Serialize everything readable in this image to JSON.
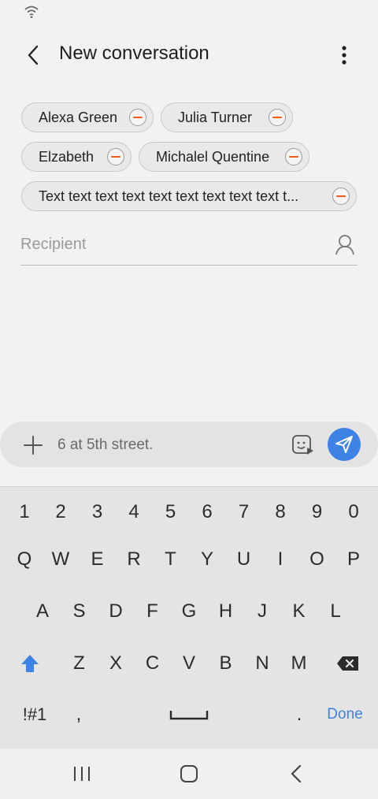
{
  "app_bar": {
    "title": "New conversation"
  },
  "recipients": [
    {
      "name": "Alexa Green"
    },
    {
      "name": "Julia Turner"
    },
    {
      "name": "Elzabeth"
    },
    {
      "name": "Michalel Quentine"
    },
    {
      "name": "Text text text text text text text text text t..."
    }
  ],
  "recipient_field": {
    "placeholder": "Recipient"
  },
  "composer": {
    "message": "6 at 5th street."
  },
  "keyboard": {
    "numbers": [
      "1",
      "2",
      "3",
      "4",
      "5",
      "6",
      "7",
      "8",
      "9",
      "0"
    ],
    "row1": [
      "Q",
      "W",
      "E",
      "R",
      "T",
      "Y",
      "U",
      "I",
      "O",
      "P"
    ],
    "row2": [
      "A",
      "S",
      "D",
      "F",
      "G",
      "H",
      "J",
      "K",
      "L"
    ],
    "row3": [
      "Z",
      "X",
      "C",
      "V",
      "B",
      "N",
      "M"
    ],
    "symbols_label": "!#1",
    "comma": ",",
    "period": ".",
    "done_label": "Done"
  },
  "colors": {
    "accent": "#3e82e5",
    "remove": "#f05a1e",
    "chip_bg": "#e9e9e9"
  }
}
